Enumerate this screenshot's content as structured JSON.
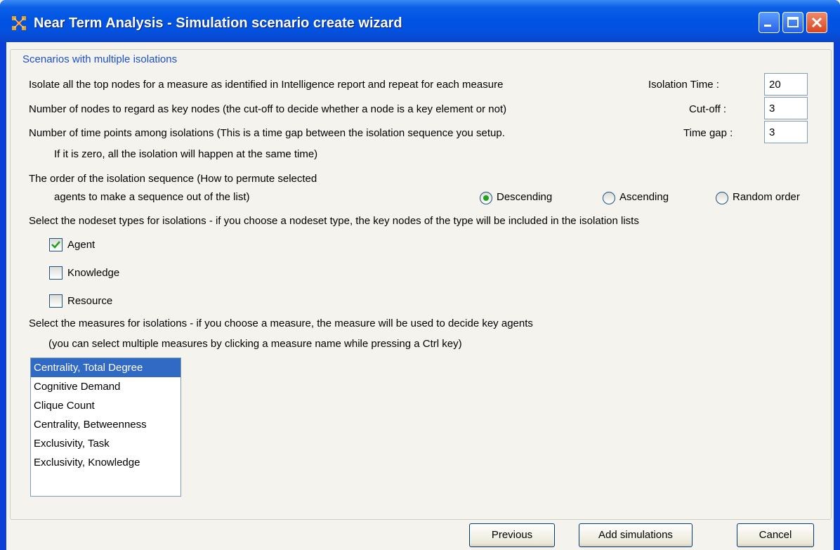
{
  "window": {
    "title": "Near Term Analysis - Simulation scenario create wizard"
  },
  "panel": {
    "title": "Scenarios with multiple isolations"
  },
  "rows": {
    "isolate_text": "Isolate all the top nodes for a measure as identified in Intelligence report and repeat for each measure",
    "isolation_time_label": "Isolation Time :",
    "isolation_time_value": "20",
    "key_nodes_text": "Number of nodes to regard as key nodes (the cut-off to decide whether a node is a key element or not)",
    "cutoff_label": "Cut-off :",
    "cutoff_value": "3",
    "time_points_text": "Number of time points among isolations (This is a time gap between the isolation sequence you setup.",
    "time_gap_label": "Time gap :",
    "time_gap_value": "3",
    "time_points_text2": "If it is zero, all the isolation will happen at the same time)"
  },
  "order": {
    "text1": "The order of the isolation sequence (How to permute selected",
    "text2": "agents to make a sequence out of the list)",
    "options": [
      "Descending",
      "Ascending",
      "Random order"
    ],
    "selected": "Descending"
  },
  "nodeset": {
    "text": "Select the nodeset types for isolations - if you choose a nodeset type, the key nodes of the type will be included in the isolation lists",
    "items": [
      {
        "label": "Agent",
        "checked": true
      },
      {
        "label": "Knowledge",
        "checked": false
      },
      {
        "label": "Resource",
        "checked": false
      }
    ]
  },
  "measures": {
    "text1": "Select the measures for isolations - if you choose a measure, the measure will be used to decide key agents",
    "text2": "(you can select multiple measures by clicking a measure name while pressing a Ctrl key)",
    "items": [
      "Centrality, Total Degree",
      "Cognitive Demand",
      "Clique Count",
      "Centrality, Betweenness",
      "Exclusivity, Task",
      "Exclusivity, Knowledge"
    ],
    "selected": "Centrality, Total Degree"
  },
  "buttons": {
    "previous": "Previous",
    "add": "Add simulations",
    "cancel": "Cancel"
  },
  "colors": {
    "titlebar": "#0054e3",
    "selection": "#316ac5",
    "panel_title": "#1b4fcf"
  }
}
